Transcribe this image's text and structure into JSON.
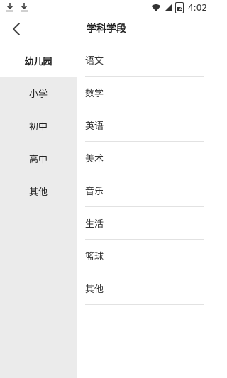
{
  "status_bar": {
    "time": "4:02",
    "battery": "2",
    "icons": [
      "download-icon",
      "download-icon",
      "wifi-icon",
      "signal-icon",
      "battery-icon"
    ]
  },
  "header": {
    "title": "学科学段",
    "back_icon": "chevron-left-icon"
  },
  "sidebar": {
    "items": [
      {
        "label": "幼儿园",
        "active": true
      },
      {
        "label": "小学",
        "active": false
      },
      {
        "label": "初中",
        "active": false
      },
      {
        "label": "高中",
        "active": false
      },
      {
        "label": "其他",
        "active": false
      }
    ]
  },
  "subjects": {
    "items": [
      {
        "label": "语文"
      },
      {
        "label": "数学"
      },
      {
        "label": "英语"
      },
      {
        "label": "美术"
      },
      {
        "label": "音乐"
      },
      {
        "label": "生活"
      },
      {
        "label": "篮球"
      },
      {
        "label": "其他"
      }
    ]
  },
  "colors": {
    "sidebar_bg": "#ebebeb",
    "active_bg": "#ffffff",
    "divider": "#e2e2e2",
    "text": "#222222"
  }
}
